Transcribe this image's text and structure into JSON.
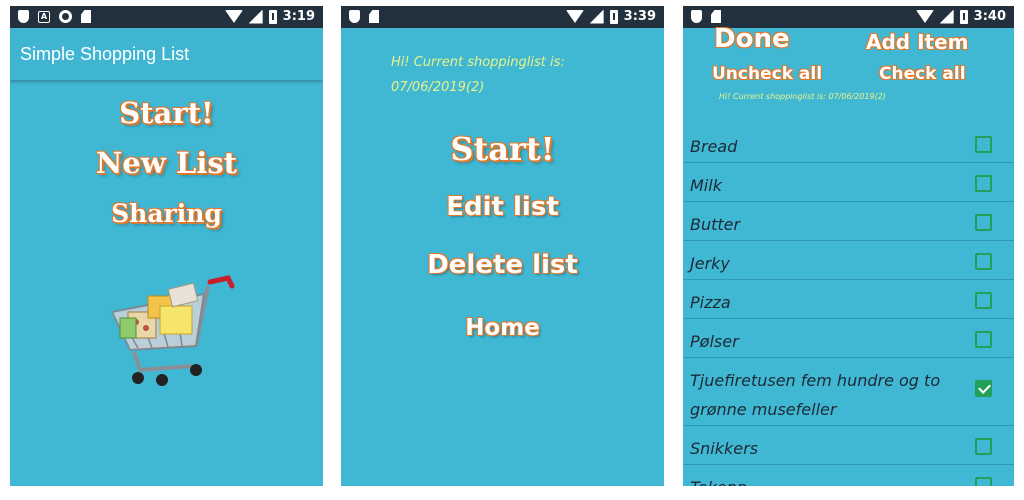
{
  "colors": {
    "background": "#40b8d4",
    "accent_outline": "#e0782a",
    "checkbox": "#22a05a",
    "greeting_text": "#e9f28a"
  },
  "screen1": {
    "status": {
      "time": "3:19"
    },
    "app_title": "Simple Shopping List",
    "menu": [
      "Start!",
      "New List",
      "Sharing"
    ],
    "image": "shopping-cart-illustration"
  },
  "screen2": {
    "status": {
      "time": "3:39"
    },
    "greeting_line1": "Hi! Current shoppinglist is:",
    "greeting_line2": "07/06/2019(2)",
    "start_label": "Start!",
    "edit_label": "Edit list",
    "delete_label": "Delete list",
    "home_label": "Home"
  },
  "screen3": {
    "status": {
      "time": "3:40"
    },
    "done_label": "Done",
    "add_item_label": "Add Item",
    "uncheck_all_label": "Uncheck all",
    "check_all_label": "Check all",
    "greeting": "Hi! Current shoppinglist is: 07/06/2019(2)",
    "items": [
      {
        "name": "Bread",
        "checked": false
      },
      {
        "name": "Milk",
        "checked": false
      },
      {
        "name": "Butter",
        "checked": false
      },
      {
        "name": "Jerky",
        "checked": false
      },
      {
        "name": "Pizza",
        "checked": false
      },
      {
        "name": "Pølser",
        "checked": false
      },
      {
        "name": "Tjuefiretusen fem hundre og to grønne musefeller",
        "checked": true
      },
      {
        "name": "Snikkers",
        "checked": false
      },
      {
        "name": "Tekopp",
        "checked": false
      }
    ]
  }
}
